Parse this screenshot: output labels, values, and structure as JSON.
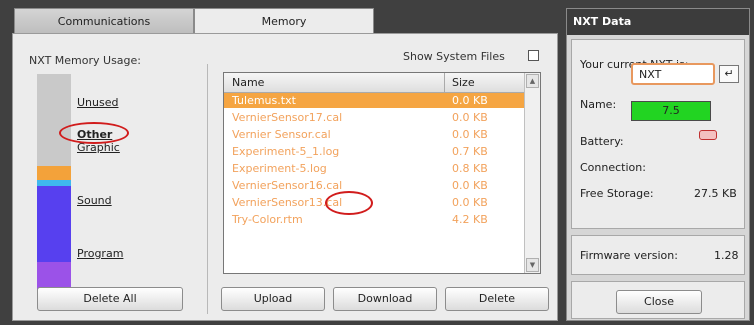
{
  "tabs": [
    {
      "label": "Communications",
      "active": false
    },
    {
      "label": "Memory",
      "active": true
    }
  ],
  "memory": {
    "usage_title": "NXT Memory Usage:",
    "categories": [
      {
        "label": "Unused",
        "color": "#c9c9c9"
      },
      {
        "label": "Other",
        "color": "#f3a23a"
      },
      {
        "label": "Graphic",
        "color": "#3fb8ee"
      },
      {
        "label": "Sound",
        "color": "#5740ef"
      },
      {
        "label": "Program",
        "color": "#9b52e8"
      }
    ],
    "delete_all_label": "Delete All",
    "show_system_files_label": "Show System Files",
    "show_system_files_checked": false,
    "columns": {
      "name": "Name",
      "size": "Size"
    },
    "files": [
      {
        "name": "Tulemus.txt",
        "size": "0.0 KB",
        "selected": true
      },
      {
        "name": "VernierSensor17.cal",
        "size": "0.0 KB",
        "selected": false
      },
      {
        "name": "Vernier Sensor.cal",
        "size": "0.0 KB",
        "selected": false
      },
      {
        "name": "Experiment-5_1.log",
        "size": "0.7 KB",
        "selected": false
      },
      {
        "name": "Experiment-5.log",
        "size": "0.8 KB",
        "selected": false
      },
      {
        "name": "VernierSensor16.cal",
        "size": "0.0 KB",
        "selected": false
      },
      {
        "name": "VernierSensor13.cal",
        "size": "0.0 KB",
        "selected": false
      },
      {
        "name": "Try-Color.rtm",
        "size": "4.2 KB",
        "selected": false
      }
    ],
    "buttons": {
      "upload": "Upload",
      "download": "Download",
      "delete": "Delete"
    }
  },
  "nxt_data": {
    "title": "NXT Data",
    "current_label": "Your current NXT is:",
    "name_label": "Name:",
    "name_value": "NXT",
    "enter_icon": "↵",
    "battery_label": "Battery:",
    "battery_value": "7.5",
    "connection_label": "Connection:",
    "connection_icon": "usb-icon",
    "free_storage_label": "Free Storage:",
    "free_storage_value": "27.5 KB",
    "firmware_label": "Firmware version:",
    "firmware_value": "1.28",
    "close_label": "Close"
  }
}
